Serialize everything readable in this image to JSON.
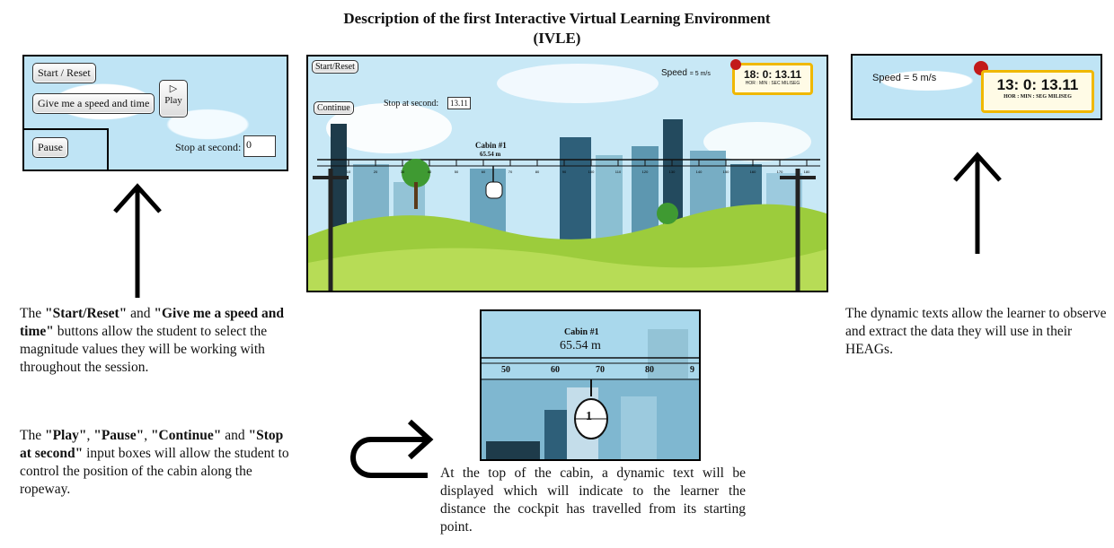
{
  "title_line1": "Description of the first Interactive Virtual Learning Environment",
  "title_line2": "(IVLE)",
  "left_panel": {
    "start_reset": "Start / Reset",
    "give_speed": "Give me a speed and time",
    "play": "Play",
    "pause": "Pause",
    "stop_label": "Stop at second:",
    "stop_value": "0"
  },
  "center_panel": {
    "start_reset": "Start/Reset",
    "continue": "Continue",
    "stop_label": "Stop at second:",
    "stop_value": "13.11",
    "speed_label": "Speed",
    "speed_value": "= 5 m/s",
    "clock": "18: 0: 13.11",
    "clock_units": "HOR : MIN : SEC MILISEG",
    "cabin_label": "Cabin #1",
    "cabin_distance": "65.54 m",
    "ruler_ticks": [
      "10",
      "20",
      "30",
      "40",
      "50",
      "60",
      "70",
      "80",
      "90",
      "100",
      "110",
      "120",
      "130",
      "140",
      "150",
      "160",
      "170",
      "180"
    ]
  },
  "right_panel": {
    "speed_text": "Speed = 5 m/s",
    "clock": "13: 0: 13.11",
    "clock_units": "HOR : MIN : SEG MILISEG"
  },
  "zoom_panel": {
    "cabin_label": "Cabin #1",
    "distance": "65.54 m",
    "ticks": [
      "50",
      "60",
      "70",
      "80",
      "9"
    ],
    "cabin_number": "1"
  },
  "text_left_1": {
    "p1": "The ",
    "b1": "\"Start/Reset\"",
    "p2": " and ",
    "b2": "\"Give me a speed and time\"",
    "p3": " buttons allow the student to select the magnitude values they will be working with throughout the session."
  },
  "text_left_2": {
    "p1": "The ",
    "b1": "\"Play\"",
    "p2": ", ",
    "b2": "\"Pause\"",
    "p3": ", ",
    "b3": "\"Continue\"",
    "p4": " and ",
    "b4": "\"Stop at second\"",
    "p5": " input boxes will allow the student to control the position of the cabin along the ropeway."
  },
  "text_center": "At the top of the cabin, a dynamic text will be displayed which will indicate to the learner the distance the cockpit has travelled from its starting point.",
  "text_right": "The dynamic texts allow the learner to observe and extract the data they will use in their HEAGs."
}
